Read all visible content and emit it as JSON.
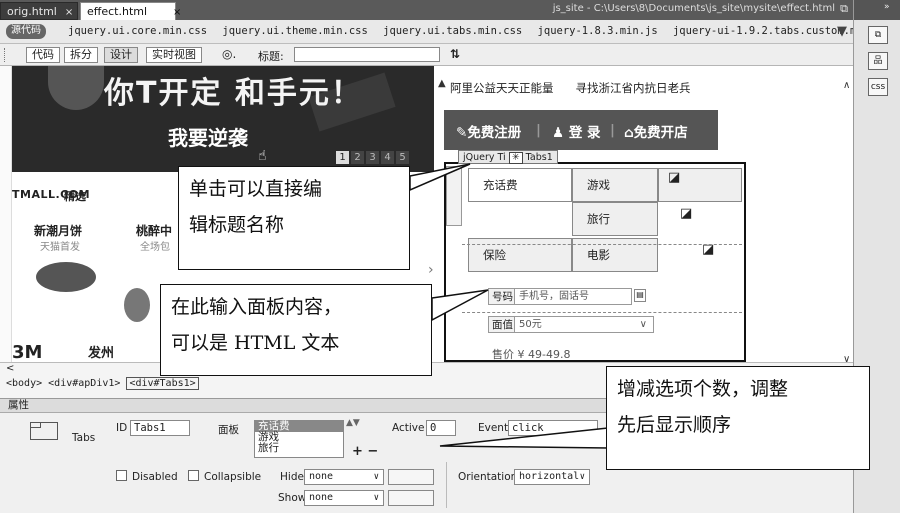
{
  "tabs": [
    {
      "label": "orig.html",
      "close": "×"
    },
    {
      "label": "effect.html",
      "close": "×"
    }
  ],
  "file_path": "js_site - C:\\Users\\8\\Documents\\js_site\\mysite\\effect.html",
  "related_files": {
    "source_button": "源代码",
    "files": [
      "jquery.ui.core.min.css",
      "jquery.ui.theme.min.css",
      "jquery.ui.tabs.min.css",
      "jquery-1.8.3.min.js",
      "jquery-ui-1.9.2.tabs.custom.min.js"
    ]
  },
  "view_toolbar": {
    "buttons": [
      "代码",
      "拆分",
      "设计",
      "实时视图"
    ],
    "title_label": "标题:",
    "title_value": ""
  },
  "page": {
    "banner_big": "你T开定 和手元！",
    "banner_cta": "我要逆袭",
    "pager": [
      "1",
      "2",
      "3",
      "4",
      "5"
    ],
    "tmall_logo": "TMALL.COM",
    "tmall_label": "精选",
    "categories": [
      {
        "title": "新潮月饼",
        "sub": "天猫首发"
      },
      {
        "title": "桃醉中",
        "sub": "全场包"
      }
    ],
    "logo_3m": "3M",
    "logo_brand": "发州",
    "top_links": [
      "阿里公益天天正能量",
      "寻找浙江省内抗日老兵"
    ],
    "auth": [
      "免费注册",
      "登 录",
      "免费开店"
    ],
    "tabs_widget_tag": {
      "prefix": "jQuery Ti",
      "name": "Tabs1"
    },
    "tabs_widget": [
      [
        "充话费",
        "游戏"
      ],
      [
        "",
        "旅行"
      ],
      [
        "保险",
        "电影"
      ]
    ],
    "form": {
      "label_number": "号码",
      "number_placeholder": "手机号，固话号",
      "label_amount": "面值",
      "amount_value": "50元",
      "price": "售价 ¥ 49-49.8"
    }
  },
  "tag_selector": {
    "arrow": "<",
    "path": [
      "<body>",
      "<div#apDiv1>",
      "<div#Tabs1>"
    ]
  },
  "properties": {
    "title": "属性",
    "widget_type": "Tabs",
    "id_label": "ID",
    "id_value": "Tabs1",
    "panels_label": "面板",
    "panels": [
      "充话费",
      "游戏",
      "旅行"
    ],
    "active_label": "Active",
    "active_value": "0",
    "event_label": "Event",
    "event_value": "click",
    "disabled_label": "Disabled",
    "collapsible_label": "Collapsible",
    "hide_label": "Hide",
    "hide_value": "none",
    "show_label": "Show",
    "show_value": "none",
    "orientation_label": "Orientation",
    "orientation_value": "horizontal",
    "add_remove": "+ −"
  },
  "callouts": [
    "单击可以直接编\n辑标题名称",
    "在此输入面板内容，\n可以是 HTML 文本",
    "增减选项个数，调整\n先后显示顺序"
  ]
}
